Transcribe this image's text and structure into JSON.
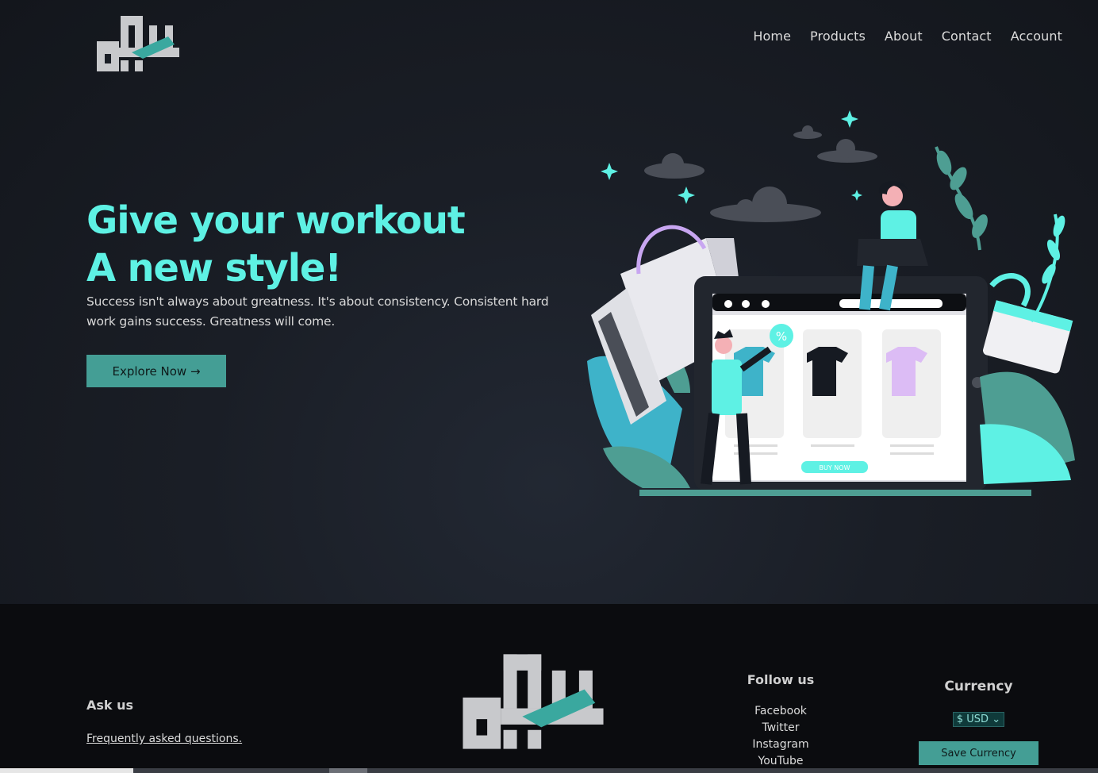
{
  "nav": {
    "items": [
      "Home",
      "Products",
      "About",
      "Contact",
      "Account"
    ]
  },
  "hero": {
    "title_line1": "Give your workout",
    "title_line2": "A new style!",
    "subtitle": "Success isn't always about greatness. It's about consistency. Consistent hard work gains success. Greatness will come.",
    "cta_label": "Explore Now →",
    "illustration_button": "BUY NOW",
    "illustration_badge": "%"
  },
  "footer": {
    "ask_title": "Ask us",
    "ask_link": "Frequently asked questions.",
    "follow_title": "Follow us",
    "follow_links": [
      "Facebook",
      "Twitter",
      "Instagram",
      "YouTube"
    ],
    "currency_title": "Currency",
    "currency_value": "$ USD",
    "save_label": "Save Currency"
  },
  "colors": {
    "accent": "#5ef1e4",
    "button": "#449e95",
    "background": "#1a1e26"
  }
}
